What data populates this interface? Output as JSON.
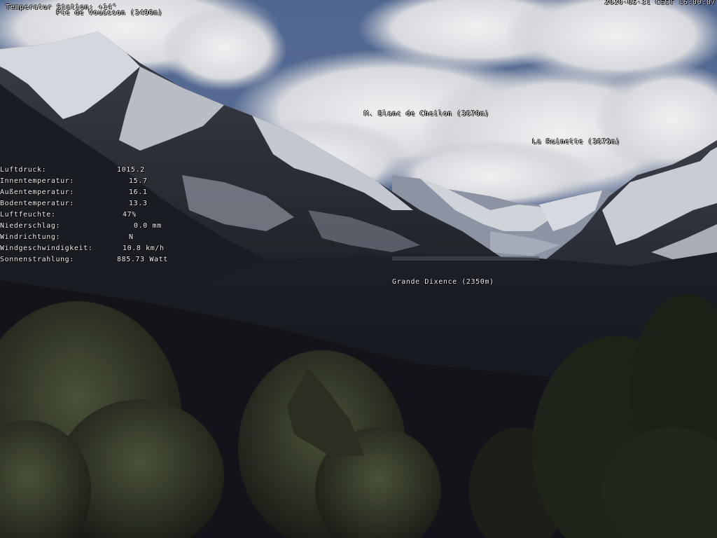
{
  "header": {
    "station_temp": "Temperatur Station: +14°",
    "timestamp": "2020-05-31 CEST 16:00:07"
  },
  "peaks": {
    "vouasson": "Pte de Vouasson (3490m)",
    "cheilon": "M. Blanc de Cheilon (3870m)",
    "ruinette": "La Ruinette (3875m)",
    "dixence": "Grande Dixence (2350m)"
  },
  "weather": [
    {
      "label": "Luftdruck:",
      "value": "1015.2"
    },
    {
      "label": "Innentemperatur:",
      "value": "15.7"
    },
    {
      "label": "Außentemperatur:",
      "value": "16.1"
    },
    {
      "label": "Bodentemperatur:",
      "value": "13.3"
    },
    {
      "label": "Luftfeuchte:",
      "value": "47%"
    },
    {
      "label": "Niederschlag:",
      "value": "0.0 mm"
    },
    {
      "label": "Windrichtung:",
      "value": "N"
    },
    {
      "label": "Windgeschwindigkeit:",
      "value": "10.8 km/h"
    },
    {
      "label": "Sonnenstrahlung:",
      "value": "885.73 Watt"
    }
  ]
}
